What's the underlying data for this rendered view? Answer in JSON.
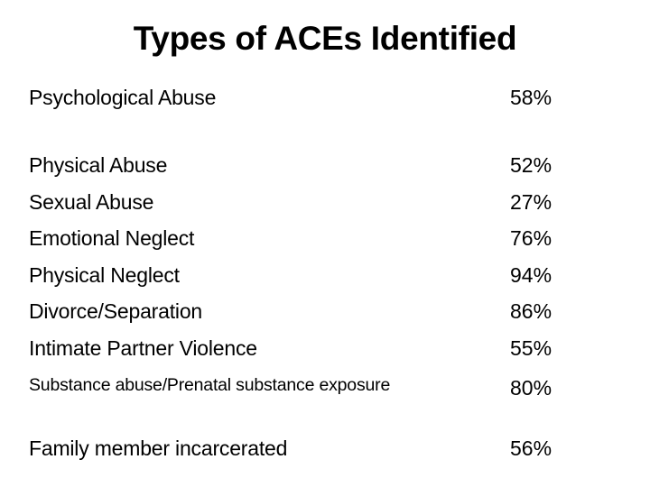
{
  "slide": {
    "title": "Types of ACEs Identified",
    "rows": [
      {
        "label": "Psychological Abuse",
        "value": "58%"
      },
      {
        "label": "Physical Abuse",
        "value": "52%"
      },
      {
        "label": "Sexual Abuse",
        "value": "27%"
      },
      {
        "label": "Emotional Neglect",
        "value": "76%"
      },
      {
        "label": "Physical Neglect",
        "value": "94%"
      },
      {
        "label": "Divorce/Separation",
        "value": "86%"
      },
      {
        "label": "Intimate Partner Violence",
        "value": "55%"
      },
      {
        "label": "Substance abuse/Prenatal substance exposure",
        "value": "80%"
      },
      {
        "label": "Family member incarcerated",
        "value": "56%"
      }
    ]
  }
}
